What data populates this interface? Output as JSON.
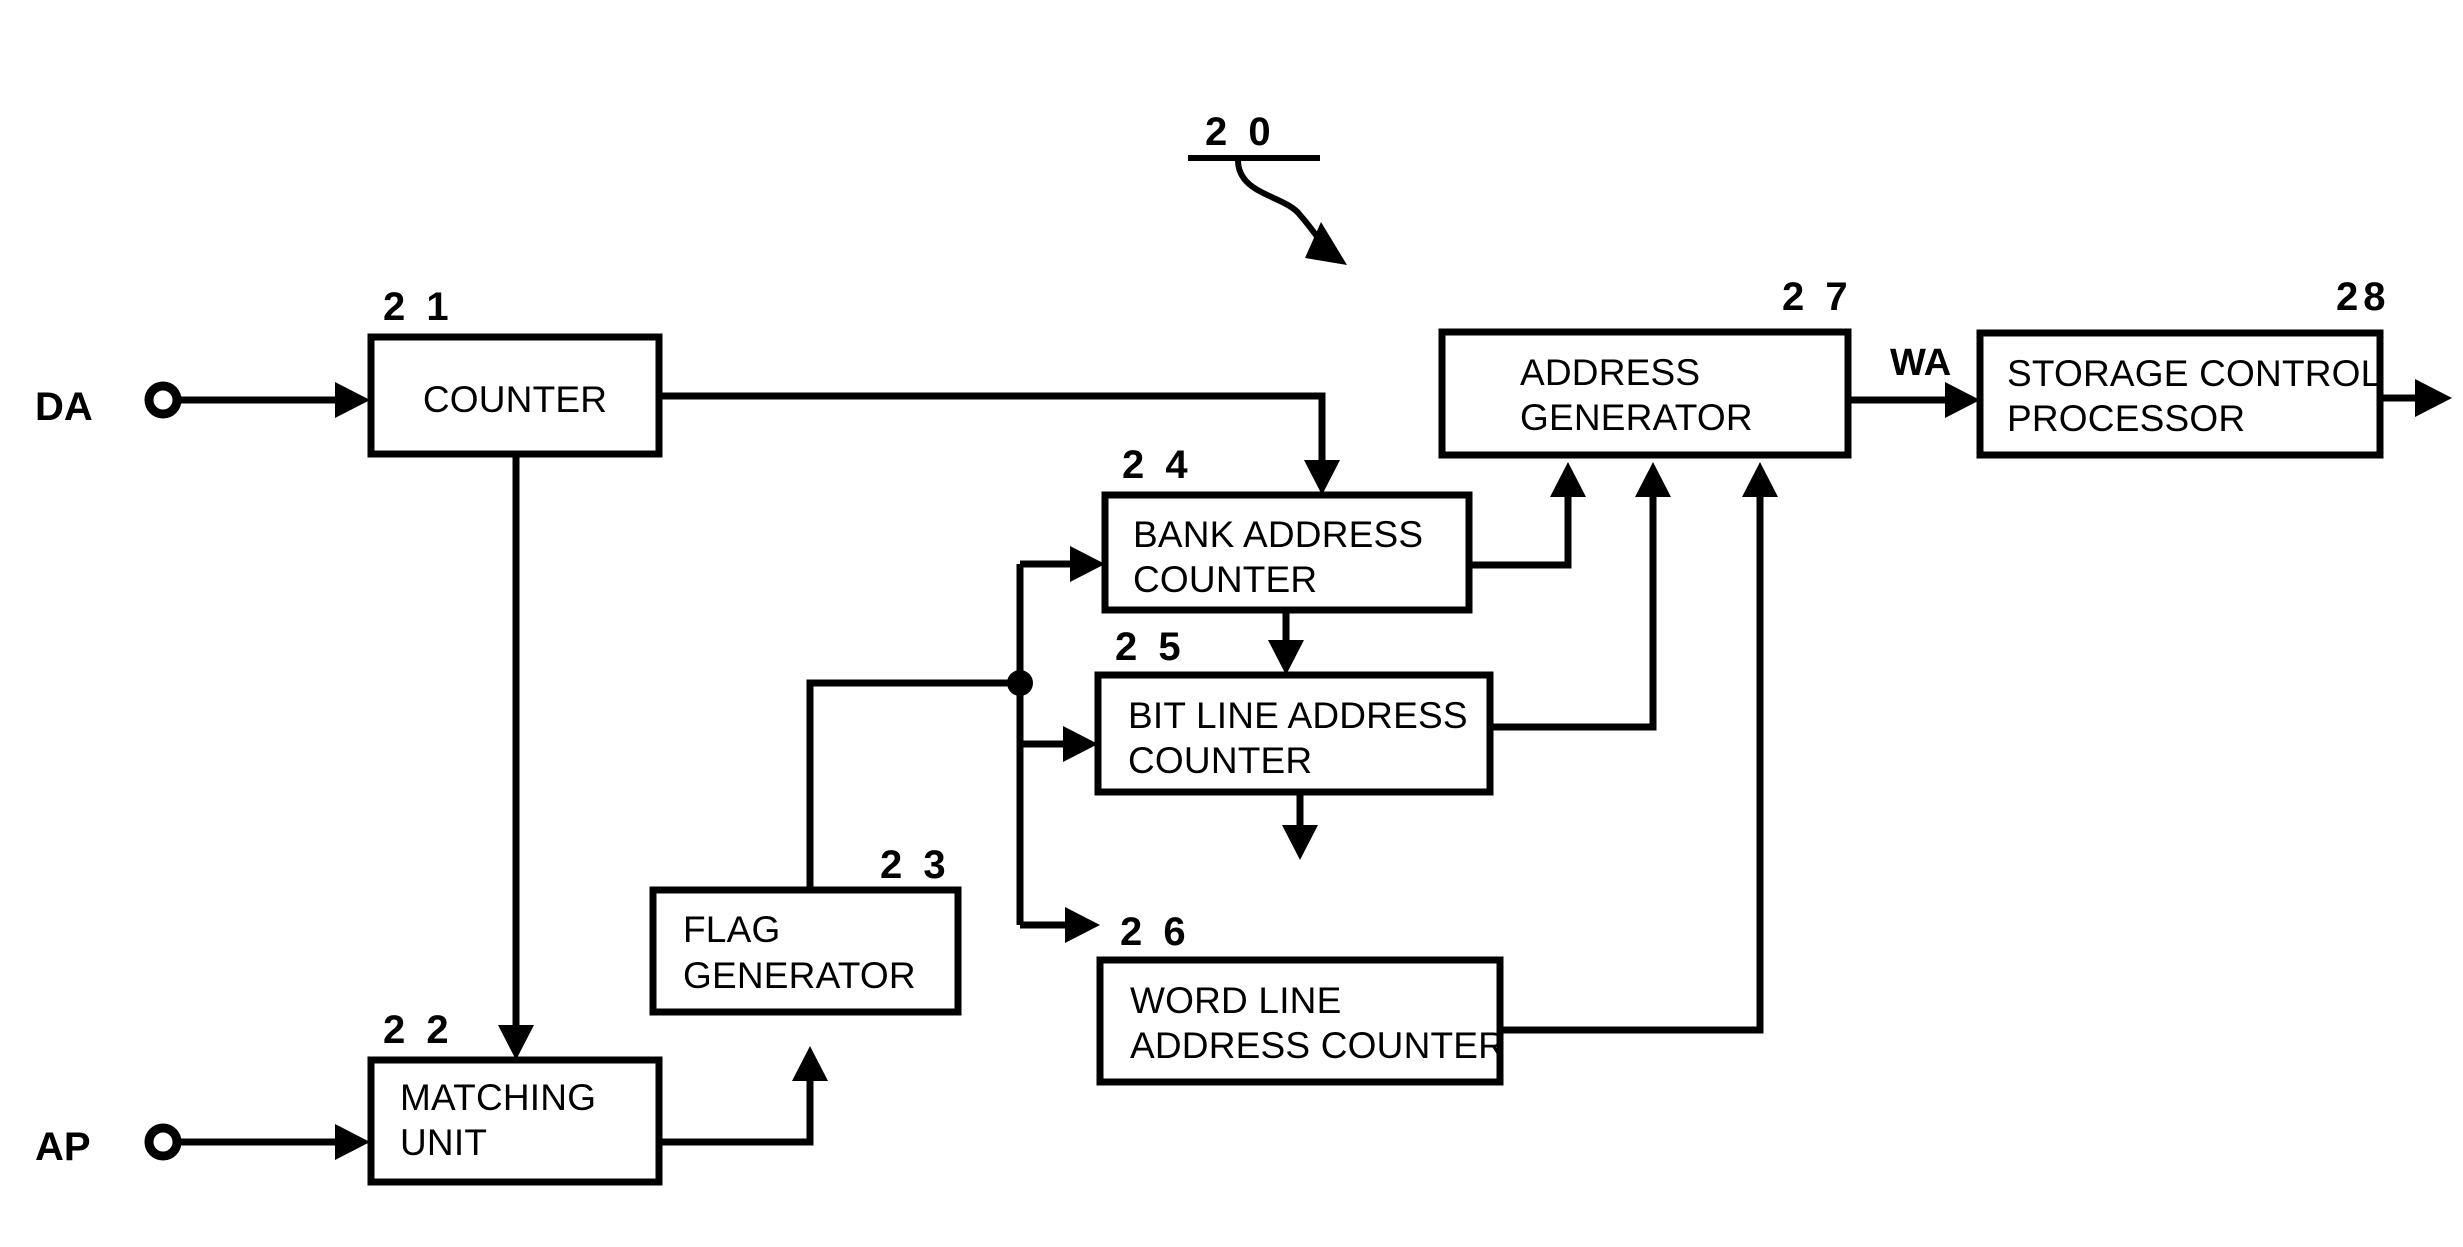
{
  "figure": {
    "type": "block-diagram",
    "overall_reference": "2 0",
    "stroke_color": "#000000",
    "background_color": "#ffffff"
  },
  "ports": {
    "data_input": {
      "label": "DA",
      "kind": "input-terminal"
    },
    "address_input": {
      "label": "AP",
      "kind": "input-terminal"
    },
    "write_address_signal": {
      "label": "WA",
      "kind": "signal-label"
    }
  },
  "blocks": [
    {
      "id": "counter",
      "ref": "2 1",
      "lines": [
        "COUNTER"
      ]
    },
    {
      "id": "matching_unit",
      "ref": "2 2",
      "lines": [
        "MATCHING",
        "UNIT"
      ]
    },
    {
      "id": "flag_generator",
      "ref": "2 3",
      "lines": [
        "FLAG",
        "GENERATOR"
      ]
    },
    {
      "id": "bank_addr",
      "ref": "2 4",
      "lines": [
        "BANK ADDRESS",
        "COUNTER"
      ]
    },
    {
      "id": "bit_line_addr",
      "ref": "2 5",
      "lines": [
        "BIT LINE ADDRESS",
        "COUNTER"
      ]
    },
    {
      "id": "word_line_addr",
      "ref": "2 6",
      "lines": [
        "WORD LINE",
        "ADDRESS COUNTER"
      ]
    },
    {
      "id": "addr_generator",
      "ref": "2 7",
      "lines": [
        "ADDRESS",
        "GENERATOR"
      ]
    },
    {
      "id": "storage_ctrl",
      "ref": "28",
      "lines": [
        "STORAGE CONTROL",
        "PROCESSOR"
      ]
    }
  ],
  "connections": [
    {
      "from": "DA terminal",
      "to": "counter"
    },
    {
      "from": "AP terminal",
      "to": "matching_unit"
    },
    {
      "from": "counter",
      "to": "bank_addr"
    },
    {
      "from": "counter",
      "to": "matching_unit"
    },
    {
      "from": "matching_unit",
      "to": "flag_generator"
    },
    {
      "from": "flag_generator",
      "to": "bank_addr"
    },
    {
      "from": "flag_generator",
      "to": "bit_line_addr"
    },
    {
      "from": "flag_generator",
      "to": "word_line_addr"
    },
    {
      "from": "bank_addr",
      "to": "bit_line_addr"
    },
    {
      "from": "bit_line_addr",
      "to": "word_line_addr"
    },
    {
      "from": "bank_addr",
      "to": "addr_generator"
    },
    {
      "from": "bit_line_addr",
      "to": "addr_generator"
    },
    {
      "from": "word_line_addr",
      "to": "addr_generator"
    },
    {
      "from": "addr_generator",
      "to": "storage_ctrl",
      "signal": "WA"
    },
    {
      "from": "storage_ctrl",
      "to": "output"
    }
  ]
}
